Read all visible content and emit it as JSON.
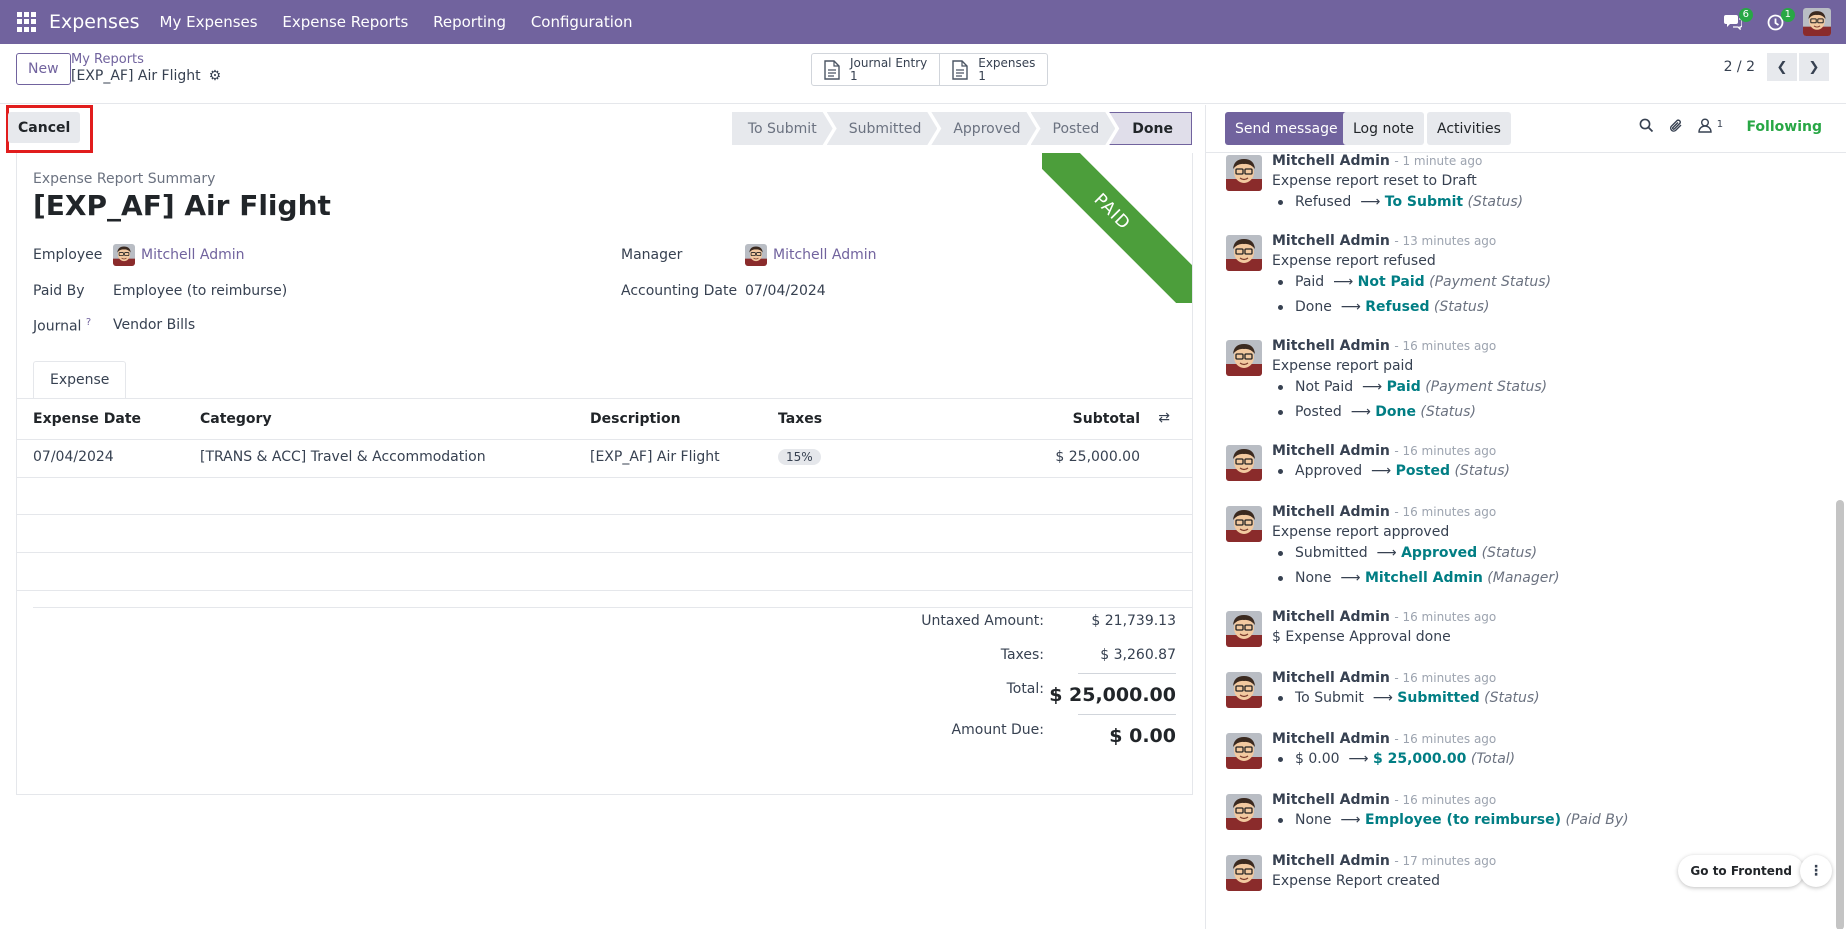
{
  "topbar": {
    "app_title": "Expenses",
    "nav": [
      "My Expenses",
      "Expense Reports",
      "Reporting",
      "Configuration"
    ],
    "messages_badge": "6",
    "activities_badge": "1"
  },
  "control": {
    "new_label": "New",
    "breadcrumb": "My Reports",
    "record_name": "[EXP_AF] Air Flight",
    "smart_buttons": [
      {
        "label": "Journal Entry",
        "count": "1"
      },
      {
        "label": "Expenses",
        "count": "1"
      }
    ],
    "pager": "2 / 2"
  },
  "status": {
    "cancel_label": "Cancel",
    "stages": [
      "To Submit",
      "Submitted",
      "Approved",
      "Posted",
      "Done"
    ],
    "active_stage": "Done"
  },
  "form": {
    "ribbon": "PAID",
    "summary_label": "Expense Report Summary",
    "title": "[EXP_AF] Air Flight",
    "employee_label": "Employee",
    "employee_value": "Mitchell Admin",
    "manager_label": "Manager",
    "manager_value": "Mitchell Admin",
    "paid_by_label": "Paid By",
    "paid_by_value": "Employee (to reimburse)",
    "accounting_date_label": "Accounting Date",
    "accounting_date_value": "07/04/2024",
    "journal_label": "Journal",
    "journal_help": "?",
    "journal_value": "Vendor Bills",
    "tab_label": "Expense"
  },
  "table": {
    "headers": [
      "Expense Date",
      "Category",
      "Description",
      "Taxes",
      "Subtotal"
    ],
    "rows": [
      {
        "date": "07/04/2024",
        "category": "[TRANS & ACC] Travel & Accommodation",
        "description": "[EXP_AF] Air Flight",
        "taxes": "15%",
        "subtotal": "$ 25,000.00"
      }
    ]
  },
  "totals": {
    "untaxed_label": "Untaxed Amount:",
    "untaxed_value": "$ 21,739.13",
    "taxes_label": "Taxes:",
    "taxes_value": "$ 3,260.87",
    "total_label": "Total:",
    "total_value": "$ 25,000.00",
    "due_label": "Amount Due:",
    "due_value": "$ 0.00"
  },
  "chatter": {
    "send_message": "Send message",
    "log_note": "Log note",
    "activities": "Activities",
    "followers_count": "1",
    "following": "Following",
    "go_frontend": "Go to Frontend",
    "messages": [
      {
        "author": "Mitchell Admin",
        "time": "- 1 minute ago",
        "body": "Expense report reset to Draft",
        "tracks": [
          {
            "old": "Refused",
            "new": "To Submit",
            "field": "(Status)"
          }
        ]
      },
      {
        "author": "Mitchell Admin",
        "time": "- 13 minutes ago",
        "body": "Expense report refused",
        "tracks": [
          {
            "old": "Paid",
            "new": "Not Paid",
            "field": "(Payment Status)"
          },
          {
            "old": "Done",
            "new": "Refused",
            "field": "(Status)"
          }
        ]
      },
      {
        "author": "Mitchell Admin",
        "time": "- 16 minutes ago",
        "body": "Expense report paid",
        "tracks": [
          {
            "old": "Not Paid",
            "new": "Paid",
            "field": "(Payment Status)"
          },
          {
            "old": "Posted",
            "new": "Done",
            "field": "(Status)"
          }
        ]
      },
      {
        "author": "Mitchell Admin",
        "time": "- 16 minutes ago",
        "body": "",
        "tracks": [
          {
            "old": "Approved",
            "new": "Posted",
            "field": "(Status)"
          }
        ]
      },
      {
        "author": "Mitchell Admin",
        "time": "- 16 minutes ago",
        "body": "Expense report approved",
        "tracks": [
          {
            "old": "Submitted",
            "new": "Approved",
            "field": "(Status)"
          },
          {
            "old": "None",
            "new": "Mitchell Admin",
            "field": "(Manager)"
          }
        ]
      },
      {
        "author": "Mitchell Admin",
        "time": "- 16 minutes ago",
        "body": "$ Expense Approval done",
        "tracks": []
      },
      {
        "author": "Mitchell Admin",
        "time": "- 16 minutes ago",
        "body": "",
        "tracks": [
          {
            "old": "To Submit",
            "new": "Submitted",
            "field": "(Status)"
          }
        ]
      },
      {
        "author": "Mitchell Admin",
        "time": "- 16 minutes ago",
        "body": "",
        "tracks": [
          {
            "old": "$ 0.00",
            "new": "$ 25,000.00",
            "field": "(Total)"
          }
        ]
      },
      {
        "author": "Mitchell Admin",
        "time": "- 16 minutes ago",
        "body": "",
        "tracks": [
          {
            "old": "None",
            "new": "Employee (to reimburse)",
            "field": "(Paid By)"
          }
        ]
      },
      {
        "author": "Mitchell Admin",
        "time": "- 17 minutes ago",
        "body": "Expense Report created",
        "tracks": []
      }
    ]
  }
}
